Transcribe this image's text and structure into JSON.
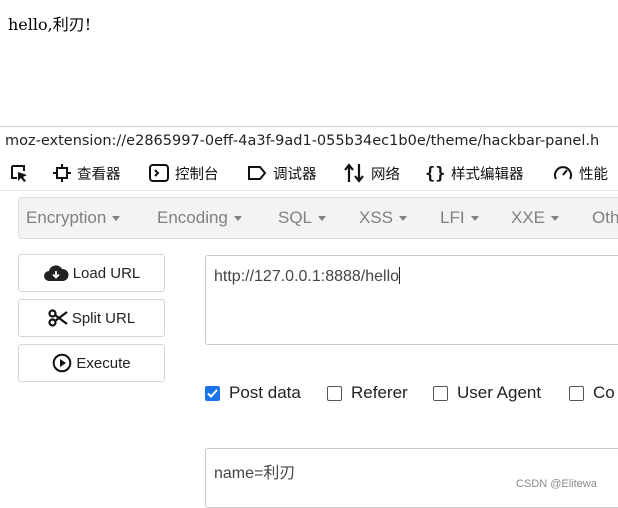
{
  "page": {
    "text": "hello,利刃!"
  },
  "devtools": {
    "url": "moz-extension://e2865997-0eff-4a3f-9ad1-055b34ec1b0e/theme/hackbar-panel.h",
    "toolbar": {
      "inspector": "查看器",
      "console": "控制台",
      "debugger": "调试器",
      "network": "网络",
      "style_editor": "样式编辑器",
      "performance": "性能"
    }
  },
  "hackbar": {
    "menu": [
      {
        "label": "Encryption"
      },
      {
        "label": "Encoding"
      },
      {
        "label": "SQL"
      },
      {
        "label": "XSS"
      },
      {
        "label": "LFI"
      },
      {
        "label": "XXE"
      },
      {
        "label": "Oth"
      }
    ],
    "buttons": {
      "load_url": "Load URL",
      "split_url": "Split URL",
      "execute": "Execute"
    },
    "url_value": "http://127.0.0.1:8888/hello",
    "options": [
      {
        "label": "Post data",
        "checked": true
      },
      {
        "label": "Referer",
        "checked": false
      },
      {
        "label": "User Agent",
        "checked": false
      },
      {
        "label": "Co",
        "checked": false
      }
    ],
    "post_value": "name=利刃"
  },
  "watermark": "CSDN @Elitewa",
  "colors": {
    "accent": "#1a73e8",
    "menu_text": "#808080"
  }
}
